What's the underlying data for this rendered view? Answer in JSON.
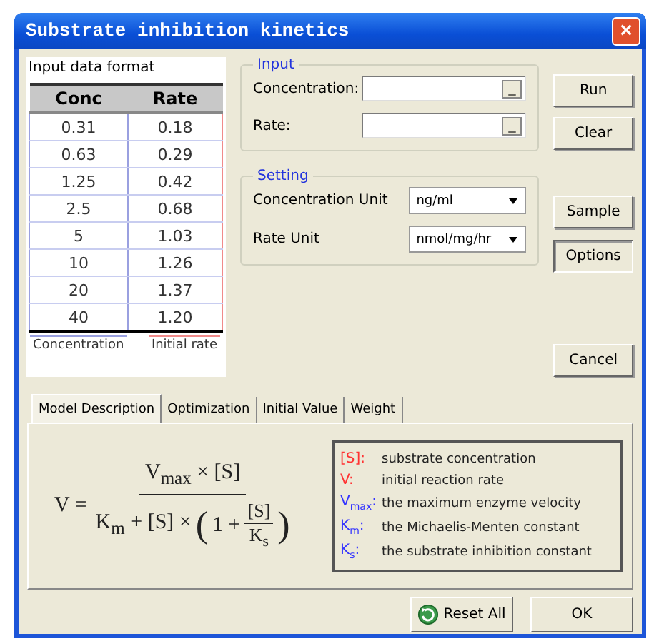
{
  "window": {
    "title": "Substrate inhibition kinetics",
    "close": "×"
  },
  "data_format": {
    "label": "Input data format",
    "columns": [
      "Conc",
      "Rate"
    ],
    "rows": [
      [
        "0.31",
        "0.18"
      ],
      [
        "0.63",
        "0.29"
      ],
      [
        "1.25",
        "0.42"
      ],
      [
        "2.5",
        "0.68"
      ],
      [
        "5",
        "1.03"
      ],
      [
        "10",
        "1.26"
      ],
      [
        "20",
        "1.37"
      ],
      [
        "40",
        "1.20"
      ]
    ],
    "captions": [
      "Concentration",
      "Initial rate"
    ]
  },
  "input": {
    "legend": "Input",
    "fields": [
      {
        "label": "Concentration:",
        "browse": "_"
      },
      {
        "label": "Rate:",
        "browse": "_"
      }
    ]
  },
  "setting": {
    "legend": "Setting",
    "selects": [
      {
        "label": "Concentration Unit",
        "value": "ng/ml"
      },
      {
        "label": "Rate Unit",
        "value": "nmol/mg/hr"
      }
    ]
  },
  "side_buttons": [
    {
      "label": "Run",
      "pressed": false
    },
    {
      "label": "Clear",
      "pressed": false
    },
    {
      "label": "Sample",
      "pressed": false
    },
    {
      "label": "Options",
      "pressed": true
    },
    {
      "label": "Cancel",
      "pressed": false
    }
  ],
  "tabs": [
    {
      "label": "Model Description",
      "selected": true
    },
    {
      "label": "Optimization",
      "selected": false
    },
    {
      "label": "Initial Value",
      "selected": false
    },
    {
      "label": "Weight",
      "selected": false
    }
  ],
  "formula": {
    "lhs": "V =",
    "numerator": "V$_{max}$ × [S]",
    "denominator": "K$_{m}$ + [S] ×",
    "open": "(",
    "inner": "1 +",
    "inner_num": "[S]",
    "inner_den": "K$_{s}$",
    "close": ")"
  },
  "legend": [
    {
      "symbol": "[S]:",
      "color": "#ff3333",
      "text": "substrate concentration"
    },
    {
      "symbol": "V:",
      "color": "#ff3333",
      "text": "initial reaction rate"
    },
    {
      "symbol": "V$_{max}$:",
      "color": "#3333ff",
      "text": "the maximum enzyme velocity"
    },
    {
      "symbol": "K$_{m}$:",
      "color": "#3333ff",
      "text": "the Michaelis-Menten constant"
    },
    {
      "symbol": "K$_{s}$:",
      "color": "#3333ff",
      "text": "the substrate inhibition constant"
    }
  ],
  "bottom_buttons": [
    {
      "label": "Reset All",
      "kind": "icon"
    },
    {
      "label": "OK",
      "kind": "plain"
    }
  ]
}
